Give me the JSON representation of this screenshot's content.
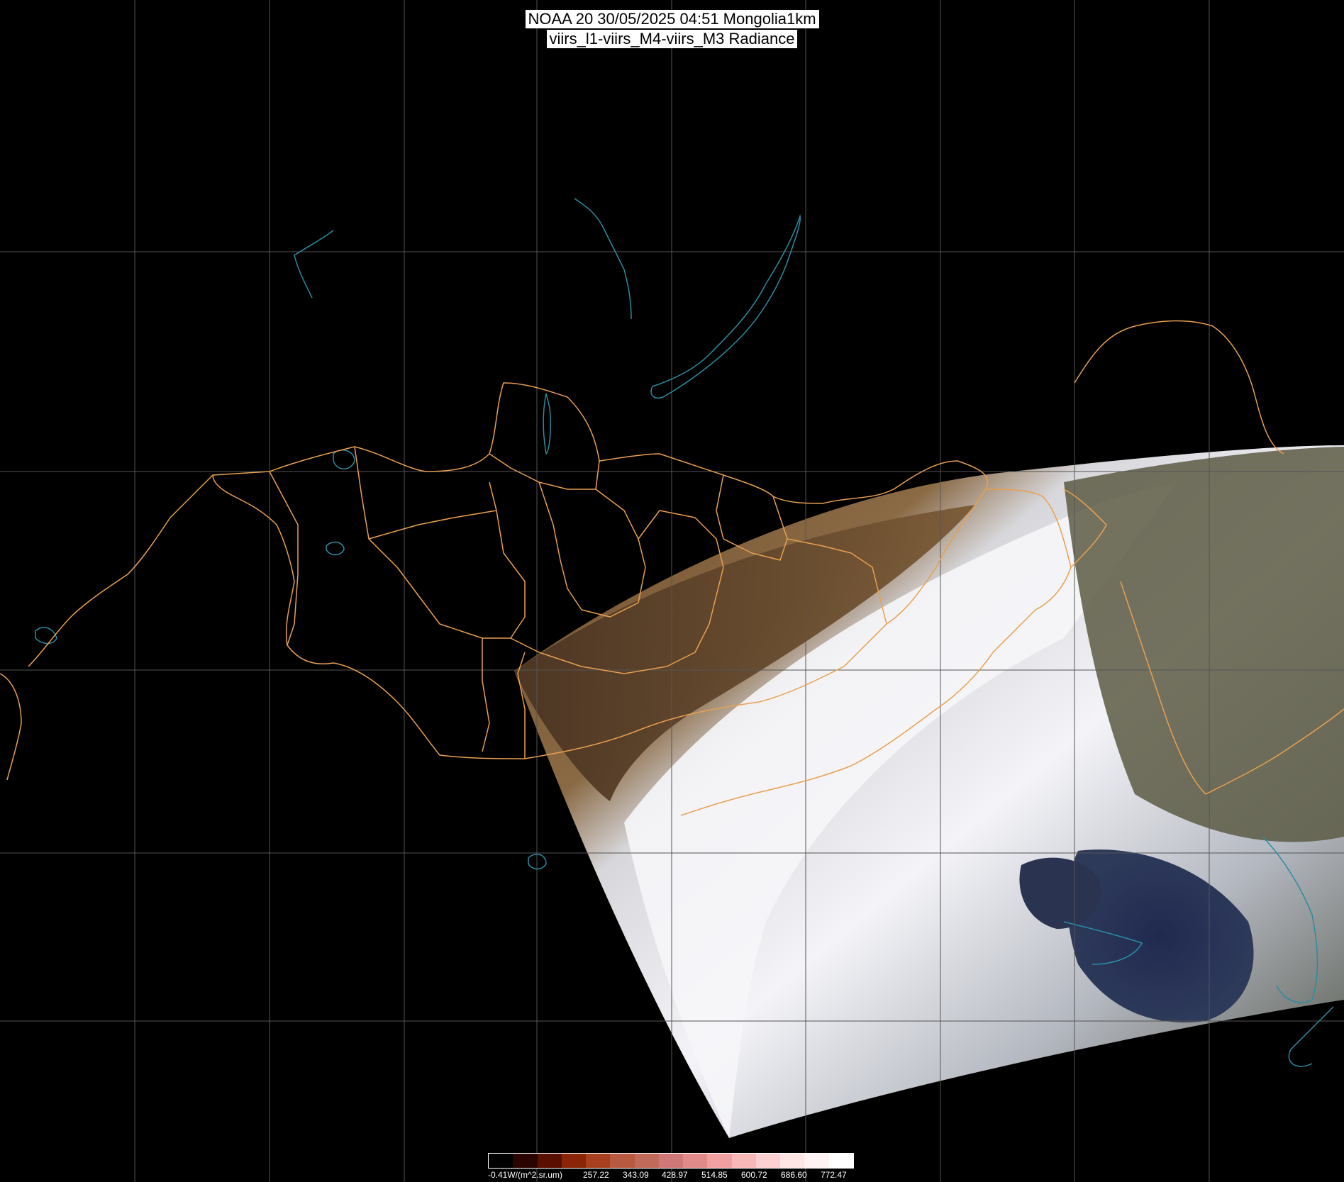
{
  "title": {
    "line1": "NOAA 20 30/05/2025 04:51 Mongolia1km",
    "line2": "viirs_l1-viirs_M4-viirs_M3 Radiance"
  },
  "colorbar": {
    "labels": [
      "-0.41W/(m^2.sr.um)",
      "257.22",
      "343.09",
      "428.97",
      "514.85",
      "600.72",
      "686.60",
      "772.47"
    ],
    "colors": [
      "#000000",
      "#2a0500",
      "#5a1000",
      "#8a2508",
      "#a84020",
      "#b85a40",
      "#c06a5a",
      "#d07878",
      "#e08a8a",
      "#f0a0a0",
      "#f8b8b8",
      "#fcd0d0",
      "#ffe4e4",
      "#fff2f2",
      "#ffffff"
    ]
  },
  "colors": {
    "grid": "#555555",
    "coast": "#2a8ca0",
    "border": "#e8a050"
  }
}
